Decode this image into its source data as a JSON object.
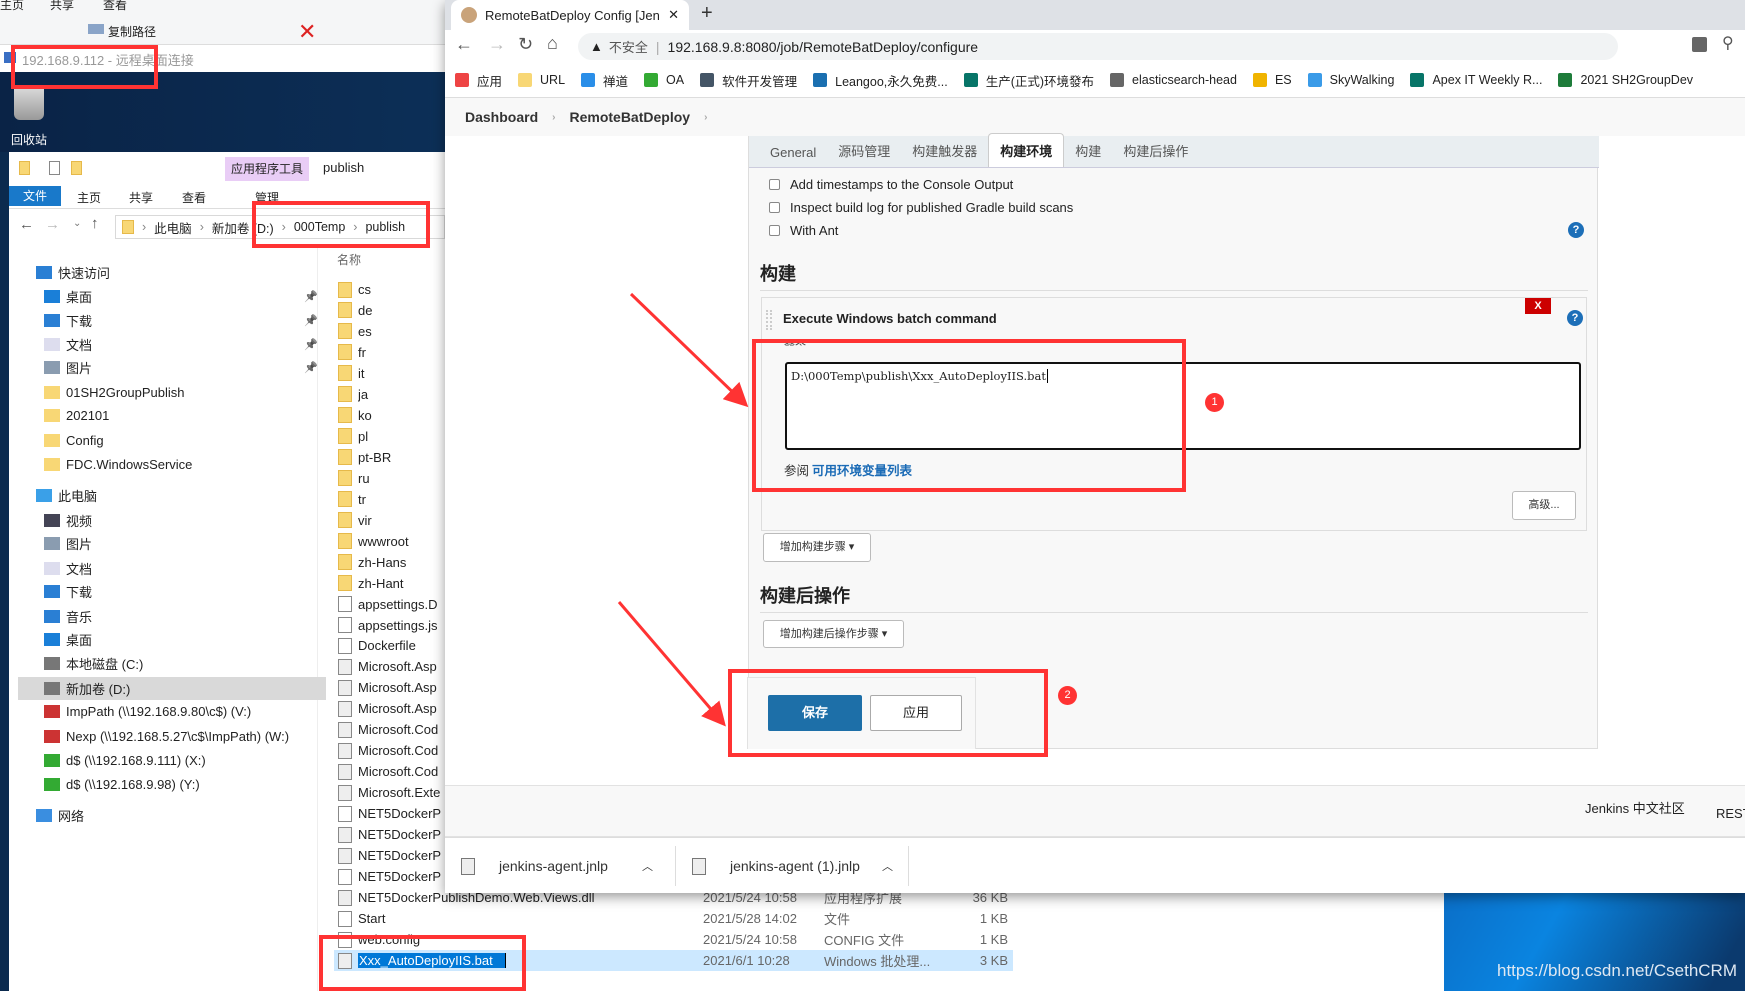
{
  "rdp_title": "192.168.9.112 - 远程桌面连接",
  "bg_ribbon": {
    "tabs": [
      "主页",
      "共享",
      "查看"
    ],
    "copy_path": "复制路径"
  },
  "desktop": {
    "recycle_bin": "回收站",
    "watermark": "https://blog.csdn.net/CsethCRM"
  },
  "explorer": {
    "context_tab": "应用程序工具",
    "window_title": "publish",
    "ribbon_tabs": [
      "文件",
      "主页",
      "共享",
      "查看",
      "管理"
    ],
    "breadcrumb": [
      "此电脑",
      "新加卷 (D:)",
      "000Temp",
      "publish"
    ],
    "column_name": "名称",
    "nav": [
      {
        "label": "快速访问",
        "icon": "star-icon",
        "lvl": 0
      },
      {
        "label": "桌面",
        "icon": "desktop-icon",
        "lvl": 1,
        "pin": true
      },
      {
        "label": "下载",
        "icon": "download-icon",
        "lvl": 1,
        "pin": true
      },
      {
        "label": "文档",
        "icon": "document-icon",
        "lvl": 1,
        "pin": true
      },
      {
        "label": "图片",
        "icon": "picture-icon",
        "lvl": 1,
        "pin": true
      },
      {
        "label": "01SH2GroupPublish",
        "icon": "folder-icon",
        "lvl": 1
      },
      {
        "label": "202101",
        "icon": "folder-icon",
        "lvl": 1
      },
      {
        "label": "Config",
        "icon": "folder-icon",
        "lvl": 1
      },
      {
        "label": "FDC.WindowsService",
        "icon": "folder-icon",
        "lvl": 1
      },
      {
        "label": "此电脑",
        "icon": "computer-icon",
        "lvl": 0
      },
      {
        "label": "视频",
        "icon": "video-icon",
        "lvl": 1
      },
      {
        "label": "图片",
        "icon": "picture-icon",
        "lvl": 1
      },
      {
        "label": "文档",
        "icon": "document-icon",
        "lvl": 1
      },
      {
        "label": "下载",
        "icon": "download-icon",
        "lvl": 1
      },
      {
        "label": "音乐",
        "icon": "music-icon",
        "lvl": 1
      },
      {
        "label": "桌面",
        "icon": "desktop-icon",
        "lvl": 1
      },
      {
        "label": "本地磁盘 (C:)",
        "icon": "drive-icon",
        "lvl": 1
      },
      {
        "label": "新加卷 (D:)",
        "icon": "drive-icon",
        "lvl": 1,
        "selected": true
      },
      {
        "label": "ImpPath (\\\\192.168.9.80\\c$) (V:)",
        "icon": "network-drive-disconnected-icon",
        "lvl": 1
      },
      {
        "label": "Nexp (\\\\192.168.5.27\\c$\\ImpPath) (W:)",
        "icon": "network-drive-disconnected-icon",
        "lvl": 1
      },
      {
        "label": "d$ (\\\\192.168.9.111) (X:)",
        "icon": "network-drive-icon",
        "lvl": 1
      },
      {
        "label": "d$ (\\\\192.168.9.98) (Y:)",
        "icon": "network-drive-icon",
        "lvl": 1
      },
      {
        "label": "网络",
        "icon": "network-icon",
        "lvl": 0
      }
    ],
    "files": [
      {
        "name": "cs",
        "t": "folder"
      },
      {
        "name": "de",
        "t": "folder"
      },
      {
        "name": "es",
        "t": "folder"
      },
      {
        "name": "fr",
        "t": "folder"
      },
      {
        "name": "it",
        "t": "folder"
      },
      {
        "name": "ja",
        "t": "folder"
      },
      {
        "name": "ko",
        "t": "folder"
      },
      {
        "name": "pl",
        "t": "folder"
      },
      {
        "name": "pt-BR",
        "t": "folder"
      },
      {
        "name": "ru",
        "t": "folder"
      },
      {
        "name": "tr",
        "t": "folder"
      },
      {
        "name": "vir",
        "t": "folder"
      },
      {
        "name": "wwwroot",
        "t": "folder"
      },
      {
        "name": "zh-Hans",
        "t": "folder"
      },
      {
        "name": "zh-Hant",
        "t": "folder"
      },
      {
        "name": "appsettings.D",
        "t": "file"
      },
      {
        "name": "appsettings.js",
        "t": "file"
      },
      {
        "name": "Dockerfile",
        "t": "file"
      },
      {
        "name": "Microsoft.Asp",
        "t": "dll"
      },
      {
        "name": "Microsoft.Asp",
        "t": "dll"
      },
      {
        "name": "Microsoft.Asp",
        "t": "dll"
      },
      {
        "name": "Microsoft.Cod",
        "t": "dll"
      },
      {
        "name": "Microsoft.Cod",
        "t": "dll"
      },
      {
        "name": "Microsoft.Cod",
        "t": "dll"
      },
      {
        "name": "Microsoft.Exte",
        "t": "dll"
      },
      {
        "name": "NET5DockerP",
        "t": "file"
      },
      {
        "name": "NET5DockerP",
        "t": "dll"
      },
      {
        "name": "NET5DockerP",
        "t": "exe"
      },
      {
        "name": "NET5DockerP",
        "t": "file"
      },
      {
        "name": "NET5DockerPublishDemo.Web.Views.dll",
        "t": "dll",
        "date": "2021/5/24 10:58",
        "kind": "应用程序扩展",
        "size": "36 KB"
      },
      {
        "name": "Start",
        "t": "file",
        "date": "2021/5/28 14:02",
        "kind": "文件",
        "size": "1 KB"
      },
      {
        "name": "web.config",
        "t": "file",
        "date": "2021/5/24 10:58",
        "kind": "CONFIG 文件",
        "size": "1 KB"
      },
      {
        "name": "Xxx_AutoDeployIIS.bat",
        "t": "dll",
        "date": "2021/6/1 10:28",
        "kind": "Windows 批处理...",
        "size": "3 KB",
        "selected": true
      }
    ]
  },
  "browser": {
    "tab_title": "RemoteBatDeploy Config [Jen",
    "insecure": "不安全",
    "url": "192.168.9.8:8080/job/RemoteBatDeploy/configure",
    "bookmarks": [
      {
        "label": "应用",
        "color": "#e44"
      },
      {
        "label": "URL",
        "color": "#f8d775"
      },
      {
        "label": "禅道",
        "color": "#2a8ee8"
      },
      {
        "label": "OA",
        "color": "#3a3"
      },
      {
        "label": "软件开发管理",
        "color": "#456"
      },
      {
        "label": "Leangoo,永久免费...",
        "color": "#1a6fb0"
      },
      {
        "label": "生产(正式)环境發布",
        "color": "#077568"
      },
      {
        "label": "elasticsearch-head",
        "color": "#666"
      },
      {
        "label": "ES",
        "color": "#f0b400"
      },
      {
        "label": "SkyWalking",
        "color": "#3a9be8"
      },
      {
        "label": "Apex IT Weekly R...",
        "color": "#077568"
      },
      {
        "label": "2021 SH2GroupDev",
        "color": "#1e7c3a"
      }
    ],
    "downloads": [
      "jenkins-agent.jnlp",
      "jenkins-agent (1).jnlp"
    ]
  },
  "jenkins": {
    "breadcrumb": [
      "Dashboard",
      "RemoteBatDeploy"
    ],
    "tabs": [
      "General",
      "源码管理",
      "构建触发器",
      "构建环境",
      "构建",
      "构建后操作"
    ],
    "active_tab": "构建环境",
    "env_options": [
      "Add timestamps to the Console Output",
      "Inspect build log for published Gradle build scans",
      "With Ant"
    ],
    "build_heading": "构建",
    "step_title": "Execute Windows batch command",
    "delete_label": "X",
    "command_label": "命令",
    "command_value": "D:\\000Temp\\publish\\Xxx_AutoDeployIIS.bat",
    "env_ref_prefix": "参阅",
    "env_ref_link": "可用环境变量列表",
    "advanced": "高级...",
    "add_build_step": "增加构建步骤 ▾",
    "post_heading": "构建后操作",
    "add_post_step": "增加构建后操作步骤 ▾",
    "save": "保存",
    "apply": "应用",
    "footer_community": "Jenkins 中文社区",
    "footer_rest": "REST"
  },
  "annotations": {
    "badge1": "1",
    "badge2": "2",
    "color": "#ff3333"
  }
}
